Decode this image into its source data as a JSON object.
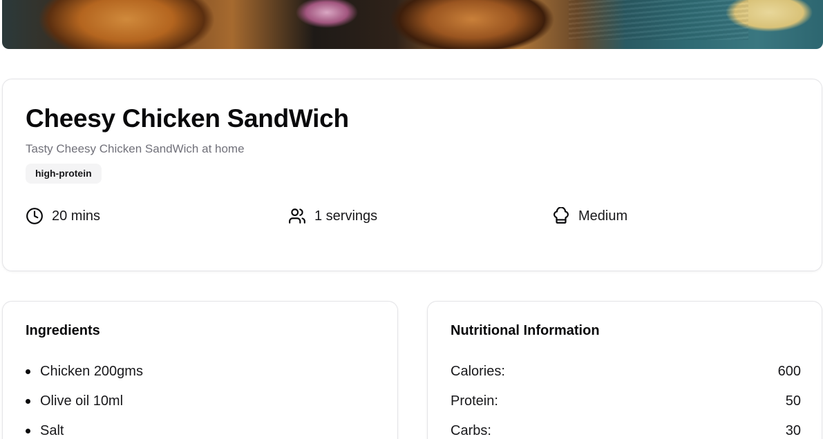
{
  "recipe": {
    "title": "Cheesy Chicken SandWich",
    "description": "Tasty Cheesy Chicken SandWich at home",
    "tags": [
      "high-protein"
    ],
    "meta": {
      "time": "20 mins",
      "servings": "1 servings",
      "difficulty": "Medium"
    }
  },
  "ingredients": {
    "title": "Ingredients",
    "items": [
      "Chicken 200gms",
      "Olive oil 10ml",
      "Salt"
    ]
  },
  "nutrition": {
    "title": "Nutritional Information",
    "rows": [
      {
        "label": "Calories:",
        "value": "600"
      },
      {
        "label": "Protein:",
        "value": "50"
      },
      {
        "label": "Carbs:",
        "value": "30"
      }
    ]
  },
  "icons": {
    "time": "clock-icon",
    "servings": "users-icon",
    "difficulty": "chef-hat-icon"
  },
  "colors": {
    "text": "#09090b",
    "muted": "#71717a",
    "tag_bg": "#f4f4f5",
    "border": "#e4e4e7"
  }
}
